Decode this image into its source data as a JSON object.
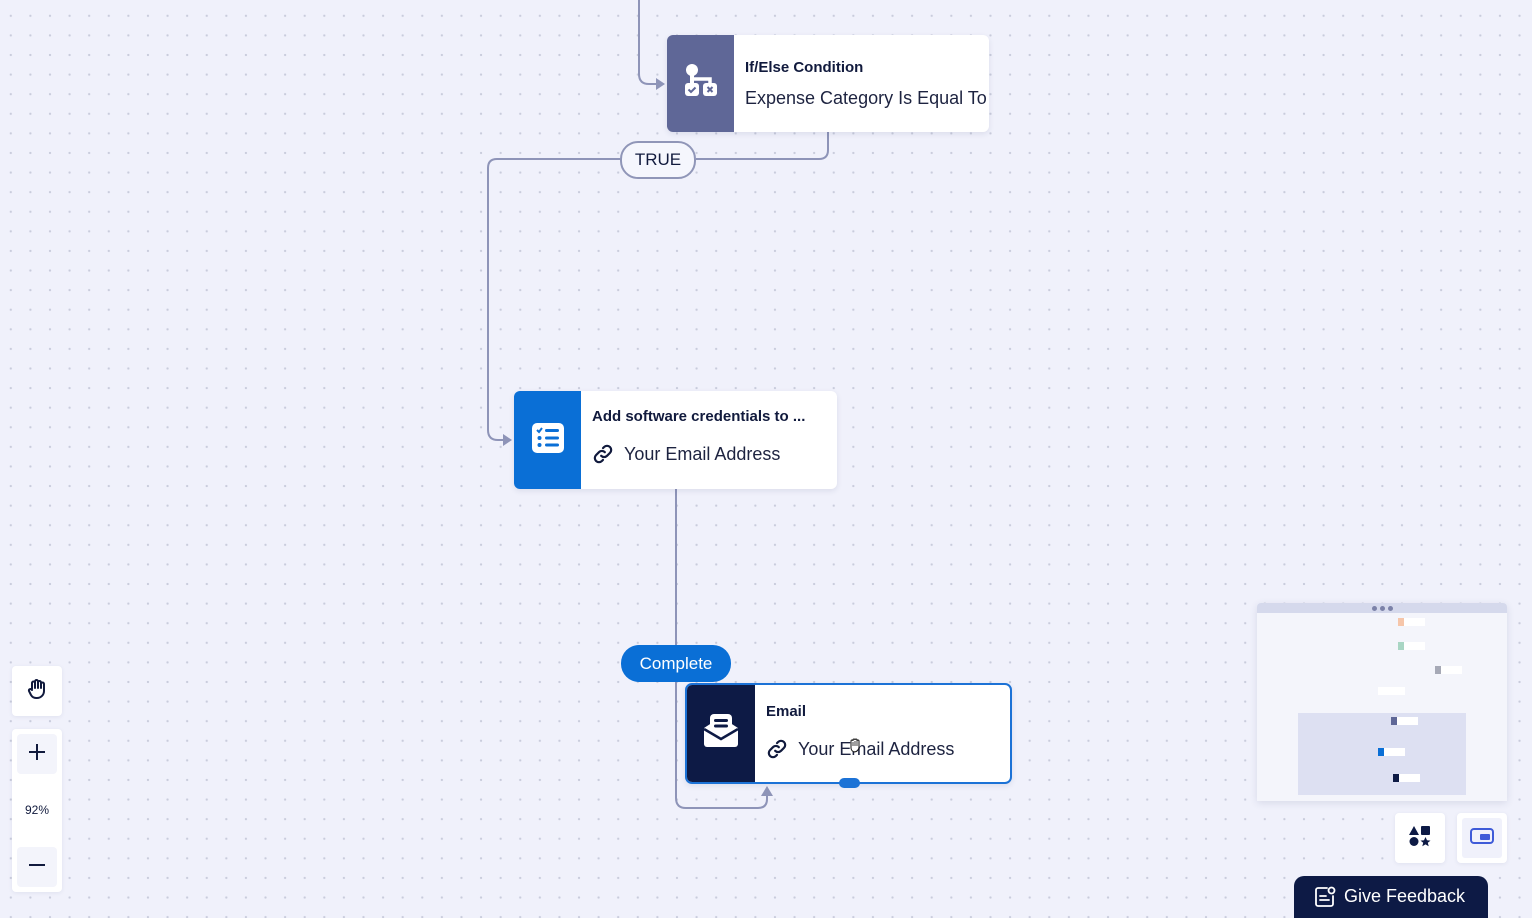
{
  "canvas": {
    "zoom_level": "92%"
  },
  "nodes": {
    "ifelse": {
      "title": "If/Else Condition",
      "subtitle": "Expense Category Is Equal To",
      "icon": "branch-condition-icon",
      "color": "#5f6797"
    },
    "add_credentials": {
      "title": "Add software credentials to ...",
      "subtitle": "Your Email Address",
      "icon": "checklist-icon",
      "color": "#0a6fd6"
    },
    "email": {
      "title": "Email",
      "subtitle": "Your Email Address",
      "icon": "envelope-icon",
      "color": "#0d1a45",
      "selected": true
    }
  },
  "edge_labels": {
    "true_label": "TRUE",
    "complete_label": "Complete"
  },
  "toolbar": {
    "pan_icon": "hand-icon",
    "zoom_in_icon": "plus-icon",
    "zoom_out_icon": "minus-icon"
  },
  "minimap": {
    "nodes": [
      {
        "color": "#f6c6aa"
      },
      {
        "color": "#a9d6c4"
      },
      {
        "color": "#a6a9b6"
      },
      {
        "color": "#ffffff"
      },
      {
        "color": "#5f6797"
      },
      {
        "color": "#0a6fd6"
      },
      {
        "color": "#0d1a45"
      }
    ]
  },
  "bottom_right": {
    "shapes_icon": "shapes-icon",
    "minimap_icon": "minimap-toggle-icon",
    "feedback_label": "Give Feedback"
  },
  "colors": {
    "accent": "#0a6fd6",
    "dark": "#0d1a45",
    "edge": "#9096b8"
  }
}
